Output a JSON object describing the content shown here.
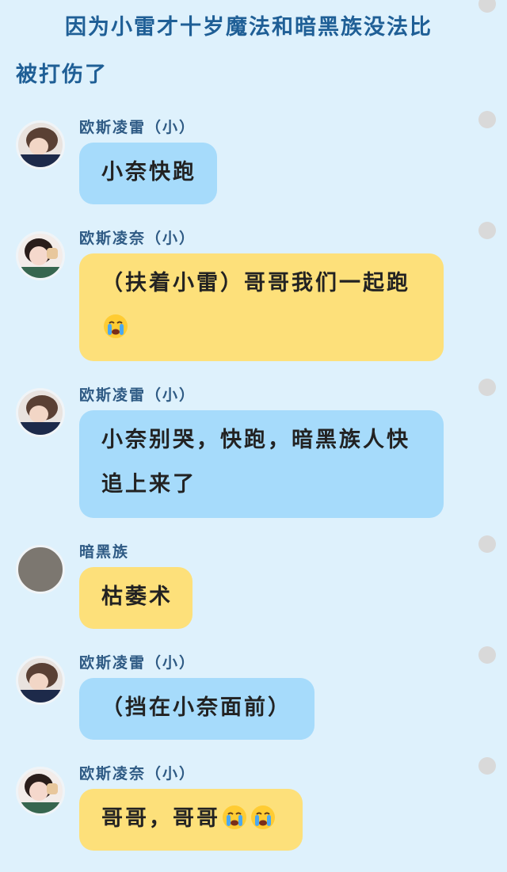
{
  "header": {
    "line1": "因为小雷才十岁魔法和暗黑族没法比",
    "line2": "被打伤了"
  },
  "messages": [
    {
      "sender": "欧斯凌雷（小）",
      "lines": [
        "小奈快跑"
      ],
      "color": "blue",
      "avatar": "boy"
    },
    {
      "sender": "欧斯凌奈（小）",
      "lines": [
        "（扶着小雷）哥哥我们一起跑"
      ],
      "trailing_emoji": "crying-face",
      "color": "yellow",
      "avatar": "girl"
    },
    {
      "sender": "欧斯凌雷（小）",
      "lines": [
        "小奈别哭，快跑，暗黑族人快",
        "追上来了"
      ],
      "color": "blue",
      "avatar": "boy"
    },
    {
      "sender": "暗黑族",
      "lines": [
        "枯萎术"
      ],
      "color": "yellow",
      "avatar": "gray"
    },
    {
      "sender": "欧斯凌雷（小）",
      "lines": [
        "（挡在小奈面前）"
      ],
      "color": "blue",
      "avatar": "boy"
    },
    {
      "sender": "欧斯凌奈（小）",
      "lines": [
        "哥哥，哥哥"
      ],
      "inline_emoji": [
        "crying-face",
        "crying-face"
      ],
      "color": "yellow",
      "avatar": "girl"
    }
  ],
  "colors": {
    "background": "#def1fc",
    "bubble_blue": "#a6dbfb",
    "bubble_yellow": "#fde07a",
    "name": "#2e5a84",
    "title": "#1f5f96"
  }
}
